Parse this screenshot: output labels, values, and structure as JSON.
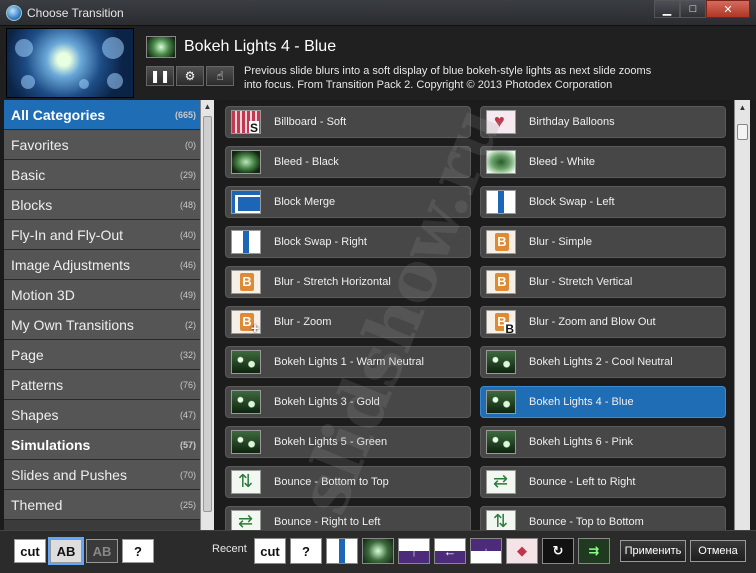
{
  "window": {
    "title": "Choose Transition"
  },
  "header": {
    "title": "Bokeh Lights 4 - Blue",
    "description": "Previous slide blurs into a soft display of blue bokeh-style lights as next slide zooms into focus. From Transition Pack 2. Copyright © 2013 Photodex Corporation"
  },
  "categories": [
    {
      "label": "All Categories",
      "count": "(665)",
      "active": true
    },
    {
      "label": "Favorites",
      "count": "(0)"
    },
    {
      "label": "Basic",
      "count": "(29)"
    },
    {
      "label": "Blocks",
      "count": "(48)"
    },
    {
      "label": "Fly-In and Fly-Out",
      "count": "(40)"
    },
    {
      "label": "Image Adjustments",
      "count": "(46)"
    },
    {
      "label": "Motion 3D",
      "count": "(49)"
    },
    {
      "label": "My Own Transitions",
      "count": "(2)"
    },
    {
      "label": "Page",
      "count": "(32)"
    },
    {
      "label": "Patterns",
      "count": "(76)"
    },
    {
      "label": "Shapes",
      "count": "(47)"
    },
    {
      "label": "Simulations",
      "count": "(57)",
      "bold": true
    },
    {
      "label": "Slides and Pushes",
      "count": "(70)"
    },
    {
      "label": "Themed",
      "count": "(25)"
    }
  ],
  "transitions": [
    {
      "label": "Billboard - Soft",
      "icon": "billboard-icon"
    },
    {
      "label": "Birthday Balloons",
      "icon": "balloon-icon"
    },
    {
      "label": "Bleed - Black",
      "icon": "bleed-black-icon"
    },
    {
      "label": "Bleed - White",
      "icon": "bleed-white-icon"
    },
    {
      "label": "Block Merge",
      "icon": "block-merge-icon"
    },
    {
      "label": "Block Swap - Left",
      "icon": "block-swap-icon"
    },
    {
      "label": "Block Swap - Right",
      "icon": "block-swap-icon"
    },
    {
      "label": "Blur - Simple",
      "icon": "blur-icon"
    },
    {
      "label": "Blur - Stretch Horizontal",
      "icon": "blur-icon"
    },
    {
      "label": "Blur - Stretch Vertical",
      "icon": "blur-icon"
    },
    {
      "label": "Blur - Zoom",
      "icon": "blur-zoom-icon"
    },
    {
      "label": "Blur - Zoom and Blow Out",
      "icon": "blur-zoom-blow-icon"
    },
    {
      "label": "Bokeh Lights 1 - Warm Neutral",
      "icon": "bokeh-icon"
    },
    {
      "label": "Bokeh Lights 2 - Cool Neutral",
      "icon": "bokeh-icon"
    },
    {
      "label": "Bokeh Lights 3 - Gold",
      "icon": "bokeh-icon"
    },
    {
      "label": "Bokeh Lights 4 - Blue",
      "icon": "bokeh-icon",
      "selected": true
    },
    {
      "label": "Bokeh Lights 5 - Green",
      "icon": "bokeh-icon"
    },
    {
      "label": "Bokeh Lights 6 - Pink",
      "icon": "bokeh-icon"
    },
    {
      "label": "Bounce - Bottom to Top",
      "icon": "bounce-icon"
    },
    {
      "label": "Bounce - Left to Right",
      "icon": "bounce-lr-icon"
    },
    {
      "label": "Bounce - Right to Left",
      "icon": "bounce-lr-icon"
    },
    {
      "label": "Bounce - Top to Bottom",
      "icon": "bounce-icon"
    }
  ],
  "toolbar": {
    "cut_label": "cut",
    "ab_label": "AB",
    "help_label": "?",
    "recent_label": "Recent",
    "apply_label": "Применить",
    "cancel_label": "Отмена"
  },
  "watermark": "slidshow.ru",
  "colors": {
    "accent": "#1f6db5"
  }
}
